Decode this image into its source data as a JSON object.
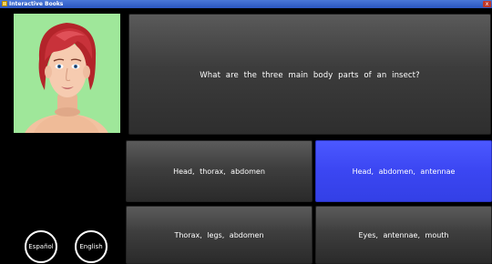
{
  "window": {
    "title": "Interactive Books",
    "close_label": "x"
  },
  "question": {
    "text": "What are the three main body parts of an insect?"
  },
  "answers": [
    {
      "label": "Head, thorax, abdomen",
      "selected": false
    },
    {
      "label": "Head, abdomen, antennae",
      "selected": true
    },
    {
      "label": "Thorax, legs, abdomen",
      "selected": false
    },
    {
      "label": "Eyes, antennae, mouth",
      "selected": false
    }
  ],
  "language_buttons": {
    "spanish": "Español",
    "english": "English"
  },
  "colors": {
    "avatar_background": "#9fe79a",
    "selected_answer": "#3b46f2",
    "tile": "#3c3c3c"
  }
}
